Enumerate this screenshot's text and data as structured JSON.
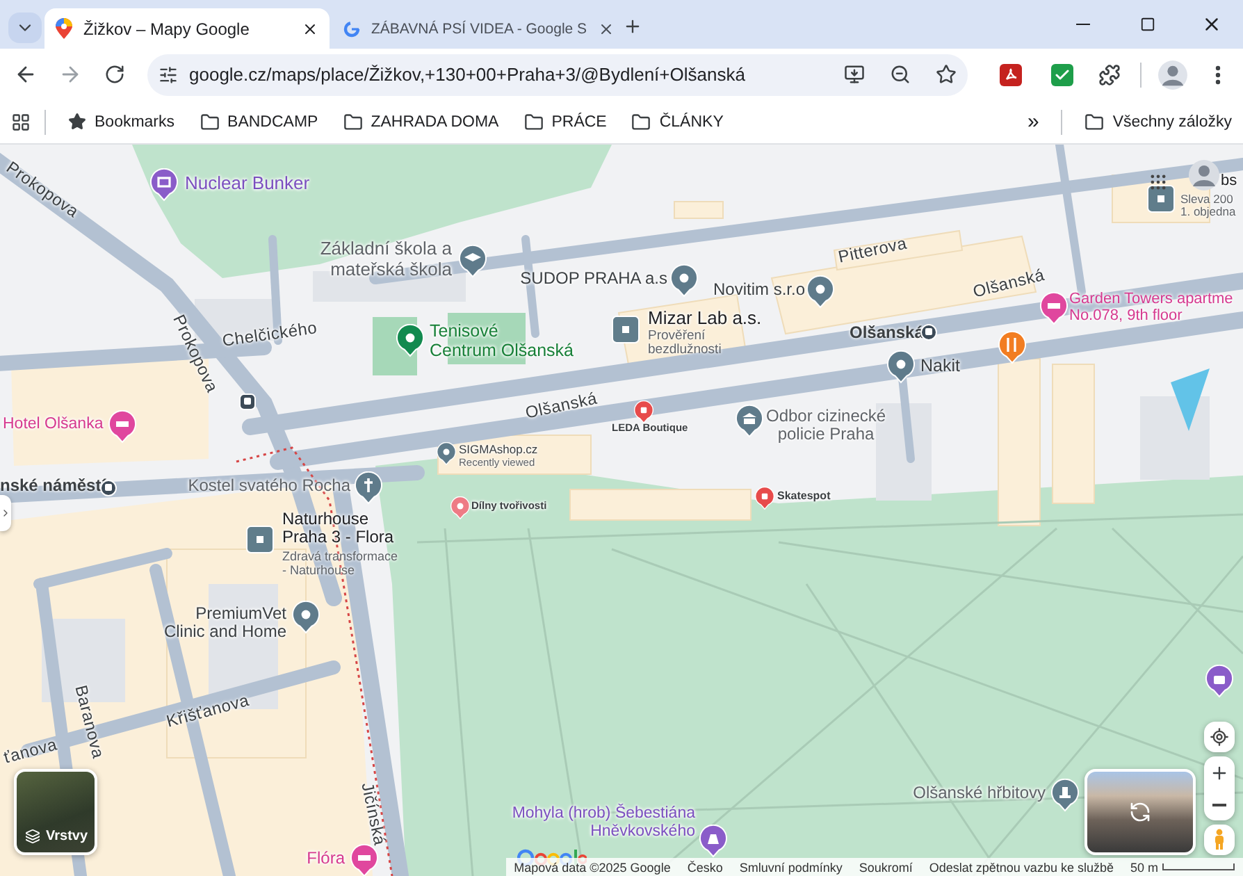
{
  "browser": {
    "tabs": [
      {
        "title": "Žižkov – Mapy Google",
        "selected": true,
        "kind": "maps"
      },
      {
        "title": "ZÁBAVNÁ PSÍ VIDEA - Google S",
        "selected": false,
        "kind": "google"
      }
    ],
    "address": "google.cz/maps/place/Žižkov,+130+00+Praha+3/@Bydlení+Olšanská",
    "bookmarks": [
      {
        "label": "Bookmarks",
        "kind": "star"
      },
      {
        "label": "BANDCAMP",
        "kind": "folder"
      },
      {
        "label": "ZAHRADA DOMA",
        "kind": "folder"
      },
      {
        "label": "PRÁCE",
        "kind": "folder"
      },
      {
        "label": "ČLÁNKY",
        "kind": "folder"
      }
    ],
    "overflow": "»",
    "all_bookmarks": "Všechny záložky"
  },
  "map": {
    "streets": [
      {
        "text": "Prokopova"
      },
      {
        "text": "Prokopova"
      },
      {
        "text": "Chelčického"
      },
      {
        "text": "Olšanská"
      },
      {
        "text": "Pitterova"
      },
      {
        "text": "Olšanská"
      },
      {
        "text": "Baranova"
      },
      {
        "text": "Křišťanova"
      },
      {
        "text": "ťanova"
      },
      {
        "text": "Jičínská"
      }
    ],
    "transit": [
      {
        "name": "nské náměstí",
        "kind": "tram"
      },
      {
        "name": "Olšanská",
        "kind": "tram"
      },
      {
        "kind": "bus"
      }
    ],
    "places": [
      {
        "kind": "museum",
        "lines": [
          "Nuclear Bunker"
        ]
      },
      {
        "kind": "school",
        "lines": [
          "Základní škola a",
          "mateřská škola"
        ]
      },
      {
        "kind": "business",
        "lines": [
          "SUDOP PRAHA a.s"
        ]
      },
      {
        "kind": "square",
        "lines": [
          "Mizar Lab a.s."
        ],
        "sub": [
          "Prověření",
          "bezdlužnosti"
        ]
      },
      {
        "kind": "business",
        "lines": [
          "Novitim s.r.o"
        ]
      },
      {
        "kind": "sport",
        "lines": [
          "Tenisové",
          "Centrum Olšanská"
        ]
      },
      {
        "kind": "hotel",
        "lines": [
          "Hotel Olšanka"
        ]
      },
      {
        "kind": "hotel",
        "lines": [
          "Garden Towers apartme",
          "No.078, 9th floor"
        ]
      },
      {
        "kind": "business",
        "lines": [
          "Nakit"
        ]
      },
      {
        "kind": "food"
      },
      {
        "kind": "shop",
        "lines": [
          "LEDA Boutique"
        ]
      },
      {
        "kind": "gov",
        "lines": [
          "Odbor cizinecké",
          "policie Praha"
        ]
      },
      {
        "kind": "business",
        "lines": [
          "SIGMAshop.cz"
        ],
        "sub": [
          "Recently viewed"
        ]
      },
      {
        "kind": "church",
        "lines": [
          "Kostel svatého Rocha"
        ]
      },
      {
        "kind": "square",
        "lines": [
          "Naturhouse",
          "Praha 3 - Flora"
        ],
        "sub": [
          "Zdravá transformace",
          "- Naturhouse"
        ]
      },
      {
        "kind": "craft",
        "lines": [
          "Dílny tvořivosti"
        ]
      },
      {
        "kind": "shop",
        "lines": [
          "Skatespot"
        ]
      },
      {
        "kind": "business",
        "lines": [
          "PremiumVet",
          "Clinic and Home"
        ]
      },
      {
        "kind": "cemetery",
        "lines": [
          "Olšanské hřbitovy"
        ]
      },
      {
        "kind": "monument",
        "lines": [
          "Mohyla (hrob) Šebestiána",
          "Hněvkovského"
        ]
      },
      {
        "kind": "hotel",
        "lines": [
          "Flóra"
        ]
      },
      {
        "kind": "photo"
      },
      {
        "kind": "square",
        "lines": [
          "bs"
        ],
        "sub": [
          "Sleva 200",
          "1. objedna"
        ]
      }
    ],
    "layers_button": "Vrstvy",
    "footer": [
      "Mapová data ©2025 Google",
      "Česko",
      "Smluvní podmínky",
      "Soukromí",
      "Odeslat zpětnou vazbu ke službě"
    ],
    "scale": "50 m"
  }
}
